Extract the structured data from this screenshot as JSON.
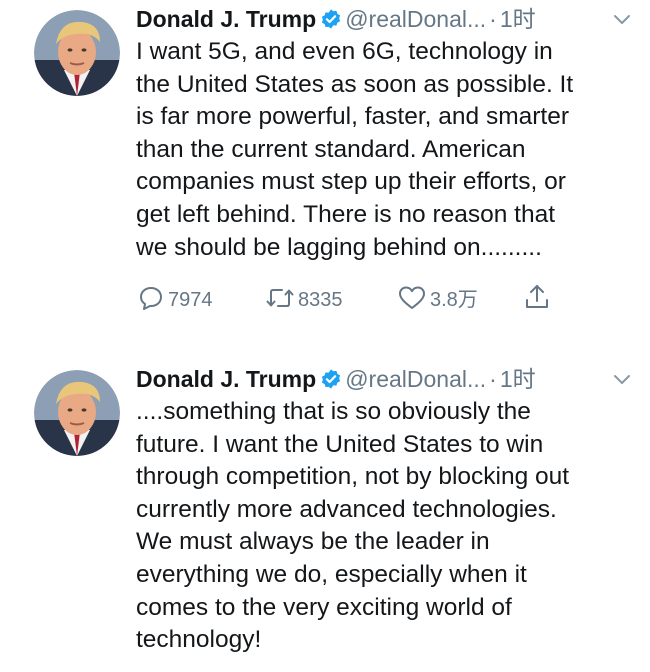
{
  "tweets": [
    {
      "author": {
        "name": "Donald J. Trump",
        "handle": "@realDonal...",
        "verified": true,
        "avatar": "avatar-photo-icon"
      },
      "separator": "·",
      "time": "1时",
      "text": "I want 5G, and even 6G, technology in\nthe United States as soon as possible. It\nis far more powerful, faster, and smarter\nthan the current standard. American\ncompanies must step up their efforts, or\nget left behind. There is no reason that\nwe should be lagging behind on.........",
      "actions": {
        "reply_count": "7974",
        "retweet_count": "8335",
        "like_count": "3.8万"
      }
    },
    {
      "author": {
        "name": "Donald J. Trump",
        "handle": "@realDonal...",
        "verified": true,
        "avatar": "avatar-photo-icon"
      },
      "separator": "·",
      "time": "1时",
      "text": "....something that is so obviously the\nfuture. I want the United States to win\nthrough competition, not by blocking out\ncurrently more advanced technologies.\nWe must always be the leader in\neverything we do, especially when it\ncomes to the very exciting world of\ntechnology!"
    }
  ],
  "colors": {
    "text": "#14171a",
    "secondary": "#657786",
    "verified": "#1da1f2"
  }
}
